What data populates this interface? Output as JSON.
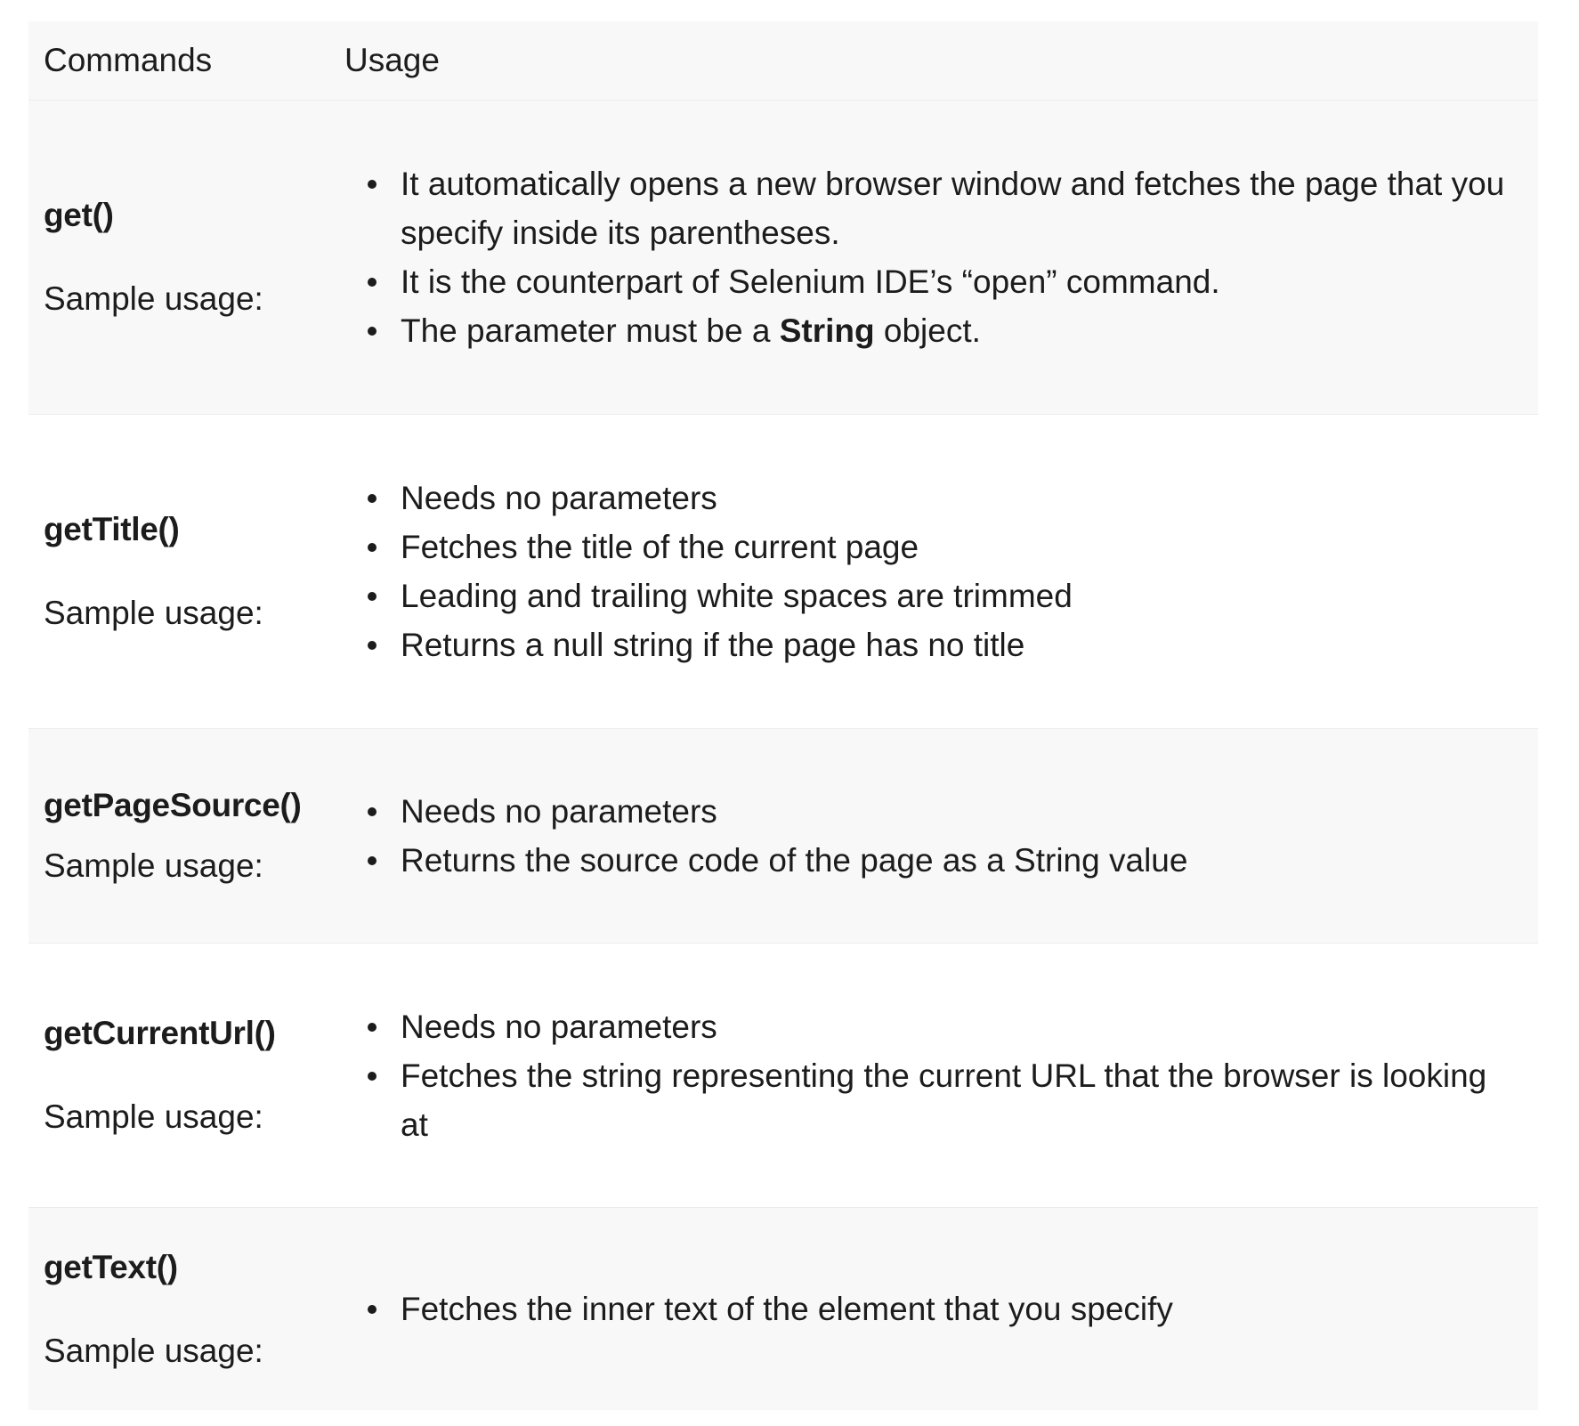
{
  "table": {
    "headers": {
      "commands": "Commands",
      "usage": "Usage"
    },
    "rows": [
      {
        "command": "get()",
        "sample_label": "Sample usage:",
        "usage": [
          {
            "parts": [
              {
                "text": "It automatically opens a new browser window and fetches the page that you specify inside its parentheses.",
                "bold": false
              }
            ]
          },
          {
            "parts": [
              {
                "text": "It is the counterpart of Selenium IDE’s “open” command.",
                "bold": false
              }
            ]
          },
          {
            "parts": [
              {
                "text": "The parameter must be a ",
                "bold": false
              },
              {
                "text": "String",
                "bold": true
              },
              {
                "text": " object.",
                "bold": false
              }
            ]
          }
        ]
      },
      {
        "command": "getTitle()",
        "sample_label": "Sample usage:",
        "usage": [
          {
            "parts": [
              {
                "text": "Needs no parameters",
                "bold": false
              }
            ]
          },
          {
            "parts": [
              {
                "text": "Fetches the title of the current page",
                "bold": false
              }
            ]
          },
          {
            "parts": [
              {
                "text": "Leading and trailing white spaces are trimmed",
                "bold": false
              }
            ]
          },
          {
            "parts": [
              {
                "text": "Returns a null string if the page has no title",
                "bold": false
              }
            ]
          }
        ]
      },
      {
        "command": "getPageSource()",
        "sample_label": "Sample usage:",
        "usage": [
          {
            "parts": [
              {
                "text": "Needs no parameters",
                "bold": false
              }
            ]
          },
          {
            "parts": [
              {
                "text": "Returns the source code of the page as a String value",
                "bold": false
              }
            ]
          }
        ]
      },
      {
        "command": "getCurrentUrl()",
        "sample_label": "Sample usage:",
        "usage": [
          {
            "parts": [
              {
                "text": "Needs no parameters",
                "bold": false
              }
            ]
          },
          {
            "parts": [
              {
                "text": "Fetches the string representing the current URL that the browser is looking at",
                "bold": false
              }
            ]
          }
        ]
      },
      {
        "command": "getText()",
        "sample_label": "Sample usage:",
        "usage": [
          {
            "parts": [
              {
                "text": "Fetches the inner text of the element that you specify",
                "bold": false
              }
            ]
          }
        ]
      }
    ]
  }
}
